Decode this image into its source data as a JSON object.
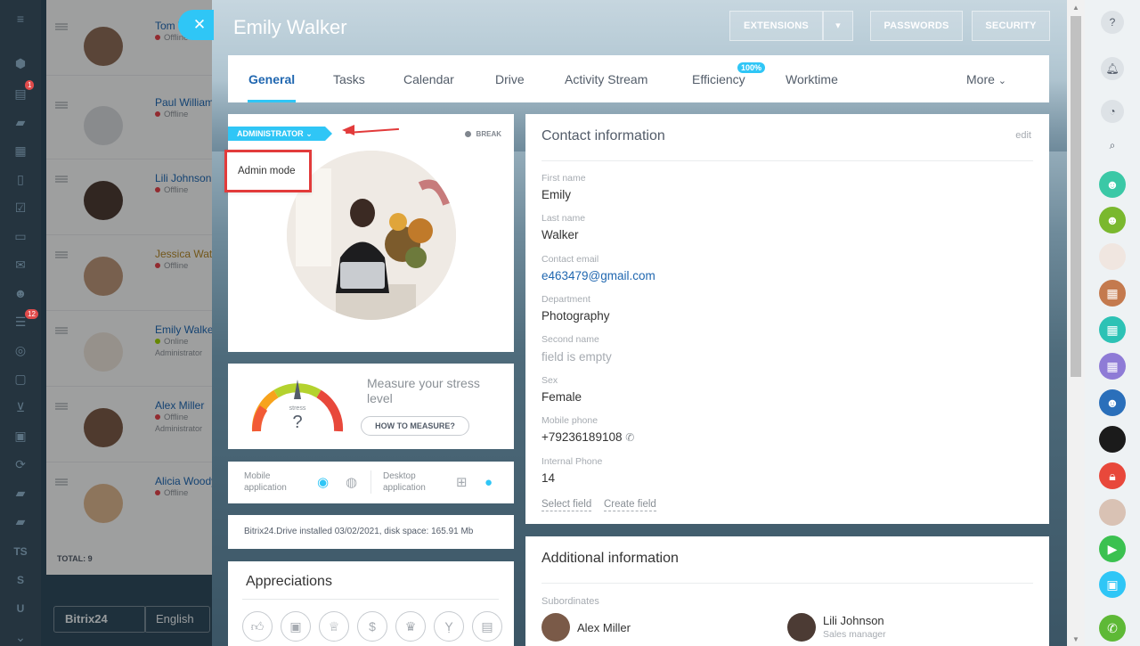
{
  "leftbar": {
    "badge_stream": "1",
    "badge_tasks": "12",
    "txt_ts": "TS",
    "txt_s": "S",
    "txt_u": "U"
  },
  "list": {
    "employees": [
      {
        "name": "Tom W",
        "status": "Offline",
        "role": ""
      },
      {
        "name": "Paul William",
        "status": "Offline",
        "role": ""
      },
      {
        "name": "Lili Johnson",
        "status": "Offline",
        "role": ""
      },
      {
        "name": "Jessica Wats",
        "status": "Offline",
        "role": ""
      },
      {
        "name": "Emily Walker",
        "status": "Online",
        "role": "Administrator"
      },
      {
        "name": "Alex Miller",
        "status": "Offline",
        "role": "Administrator"
      },
      {
        "name": "Alicia Woody",
        "status": "Offline",
        "role": ""
      }
    ],
    "total": "TOTAL: 9",
    "logo": "Bitrix24",
    "language": "English"
  },
  "header": {
    "title": "Emily Walker",
    "extensions": "EXTENSIONS",
    "passwords": "PASSWORDS",
    "security": "SECURITY"
  },
  "tabs": {
    "general": "General",
    "tasks": "Tasks",
    "calendar": "Calendar",
    "drive": "Drive",
    "activity": "Activity Stream",
    "efficiency": "Efficiency",
    "efficiency_badge": "100%",
    "worktime": "Worktime",
    "more": "More"
  },
  "profile": {
    "role_badge": "ADMINISTRATOR",
    "status": "BREAK",
    "admin_mode": "Admin mode"
  },
  "stress": {
    "label": "stress",
    "value": "?",
    "title": "Measure your stress level",
    "button": "HOW TO MEASURE?"
  },
  "apps": {
    "mobile": "Mobile application",
    "desktop": "Desktop application"
  },
  "drive_info": "Bitrix24.Drive installed 03/02/2021, disk space: 165.91 Mb",
  "appreciations": {
    "title": "Appreciations"
  },
  "contact": {
    "title": "Contact information",
    "edit": "edit",
    "fields": [
      {
        "label": "First name",
        "value": "Emily"
      },
      {
        "label": "Last name",
        "value": "Walker"
      },
      {
        "label": "Contact email",
        "value": "e463479@gmail.com"
      },
      {
        "label": "Department",
        "value": "Photography"
      },
      {
        "label": "Second name",
        "value": "field is empty"
      },
      {
        "label": "Sex",
        "value": "Female"
      },
      {
        "label": "Mobile phone",
        "value": "+79236189108"
      },
      {
        "label": "Internal Phone",
        "value": "14"
      }
    ],
    "select_field": "Select field",
    "create_field": "Create field"
  },
  "additional": {
    "title": "Additional information",
    "subordinates_label": "Subordinates",
    "subordinates": [
      {
        "name": "Alex Miller",
        "position": ""
      },
      {
        "name": "Lili Johnson",
        "position": "Sales manager"
      }
    ]
  },
  "colors": {
    "accent": "#2fc6f6",
    "link": "#2067b0",
    "highlight": "#e23b3b"
  }
}
